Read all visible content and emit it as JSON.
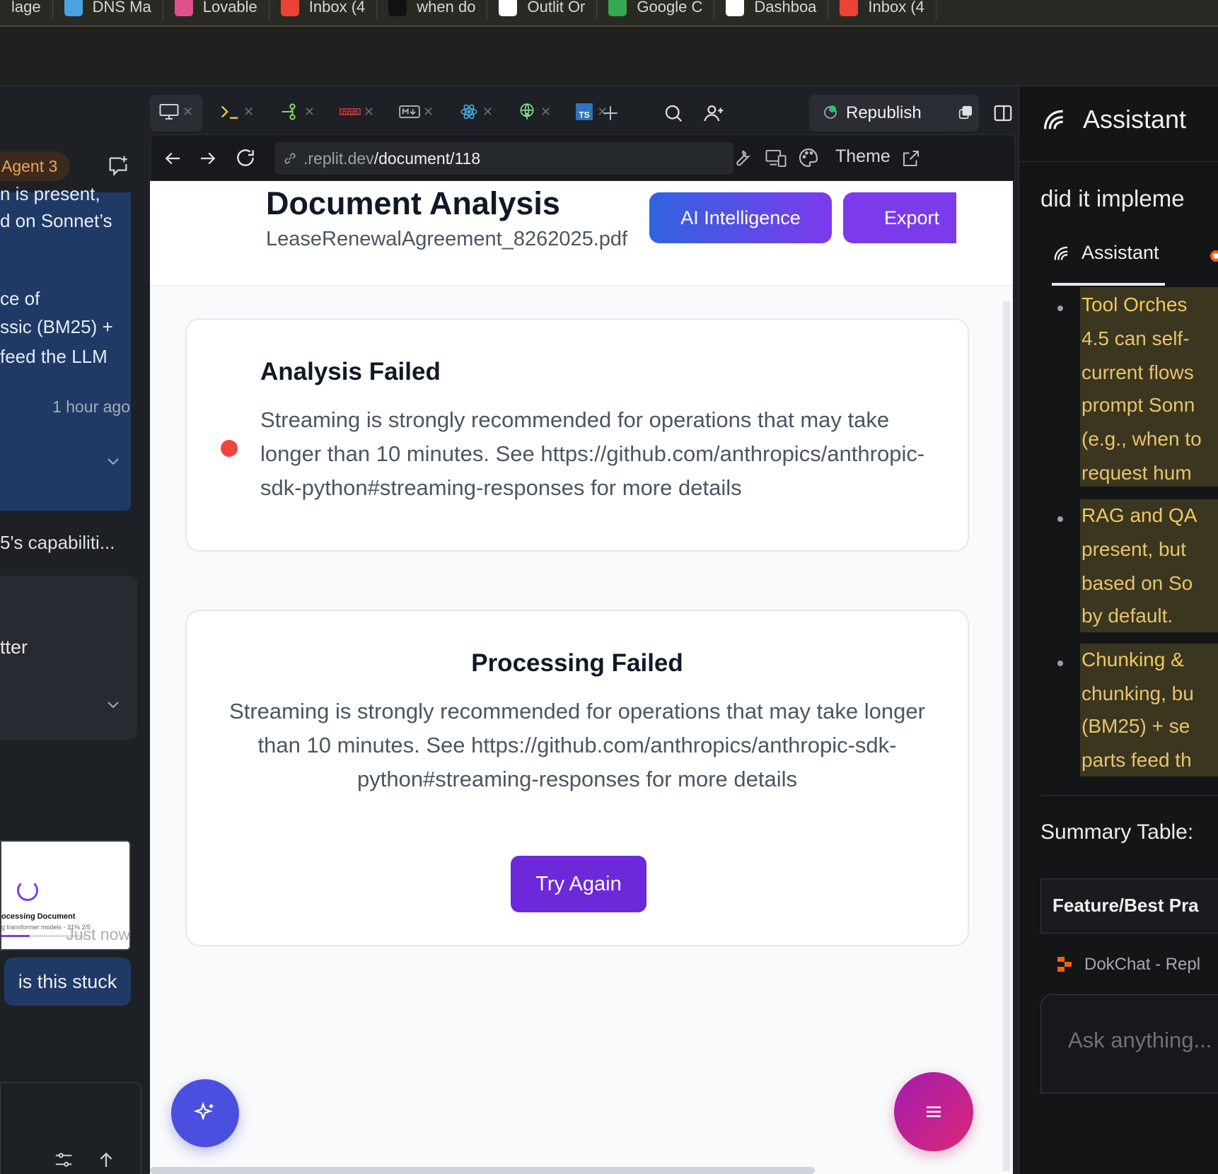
{
  "bookmarks": [
    {
      "label": "lage",
      "color": "#6b6b6b"
    },
    {
      "label": "DNS Ma",
      "color": "#4aa3df"
    },
    {
      "label": "Lovable",
      "color": "#e0508a"
    },
    {
      "label": "Inbox (4",
      "color": "#ea4335"
    },
    {
      "label": "when do",
      "color": "#111111"
    },
    {
      "label": "Outlit Or",
      "color": "#ffffff"
    },
    {
      "label": "Google C",
      "color": "#34a853"
    },
    {
      "label": "Dashboa",
      "color": "#ffffff"
    },
    {
      "label": "Inbox (4",
      "color": "#ea4335"
    }
  ],
  "left": {
    "agent_label": "Agent 3",
    "msg_lines": [
      "n is present,",
      "d on Sonnet’s",
      "ce of",
      "ssic (BM25) +",
      "feed the LLM"
    ],
    "ts1": "1 hour ago",
    "capabilities": "5's capabiliti...",
    "card_text": "tter",
    "thumb_title": "ocessing Document",
    "thumb_sub": "g transformer models - 31% 2/5",
    "user_msg": "is this stuck",
    "ts2": "Just now"
  },
  "toolbar": {
    "republish": "Republish",
    "url_host": ".replit.dev",
    "url_path": "/document/118",
    "theme": "Theme"
  },
  "page": {
    "title": "Document Analysis",
    "filename": "LeaseRenewalAgreement_8262025.pdf",
    "ai_button": "AI Intelligence",
    "export_button": "Export",
    "card1": {
      "title": "Analysis Failed",
      "body": "Streaming is strongly recommended for operations that may take longer than 10 minutes. See https://github.com/anthropics/anthropic-sdk-python#streaming-responses for more details"
    },
    "card2": {
      "title": "Processing Failed",
      "body": "Streaming is strongly recommended for operations that may take longer than 10 minutes. See https://github.com/anthropics/anthropic-sdk-python#streaming-responses for more details",
      "button": "Try Again"
    }
  },
  "right": {
    "title": "Assistant",
    "question": "did it impleme",
    "tab": "Assistant",
    "bullets": [
      [
        "Tool Orches",
        "4.5 can self-",
        "current flows",
        "prompt Sonn",
        "(e.g., when to",
        "request hum"
      ],
      [
        "RAG and QA",
        "present, but",
        "based on So",
        "by default."
      ],
      [
        "Chunking &",
        "chunking, bu",
        "(BM25) + se",
        "parts feed th"
      ]
    ],
    "summary": "Summary Table:",
    "table_header": "Feature/Best Pra",
    "dok": "DokChat - Repl",
    "ask_placeholder": "Ask anything..."
  },
  "colors": {
    "accent": "#7c3aed",
    "blue": "#2f63e0",
    "error": "#ef4444",
    "highlight": "#e8c36c"
  }
}
